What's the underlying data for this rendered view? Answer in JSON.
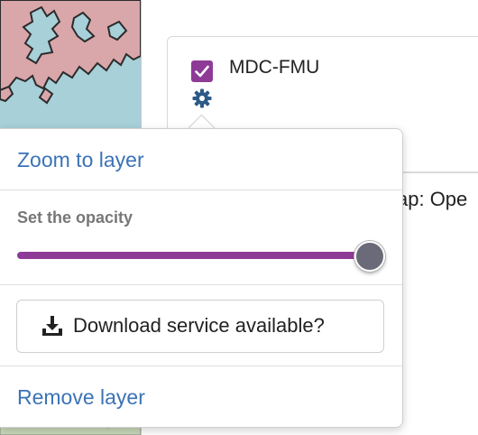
{
  "layer": {
    "name": "MDC-FMU",
    "checked": true,
    "settings_icon": "gear-icon",
    "accent_color": "#8e3b98"
  },
  "basemap_text": "ap: Ope",
  "popover": {
    "zoom_label": "Zoom to layer",
    "opacity_label": "Set the opacity",
    "opacity_value": 1.0,
    "download_label": "Download service available?",
    "download_icon": "download-icon",
    "remove_label": "Remove layer",
    "link_color": "#3b73b6"
  },
  "map": {
    "water_color": "#a7d0d8",
    "land_color": "#d9a6aa"
  }
}
